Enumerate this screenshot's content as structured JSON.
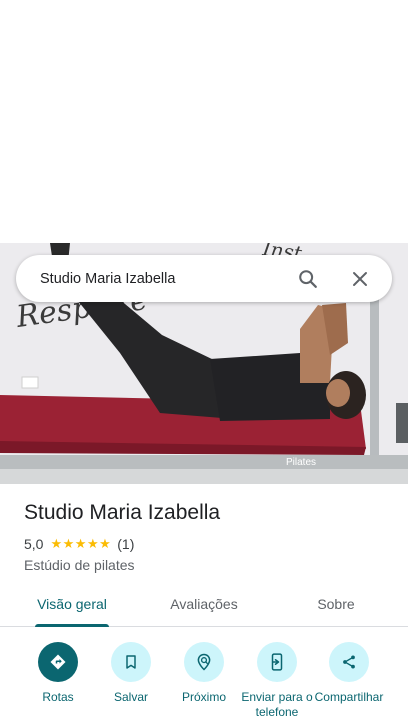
{
  "search": {
    "query": "Studio Maria Izabella"
  },
  "photo": {
    "wall_text": "Respeite",
    "wall_text_top": "Inst",
    "equipment_brand": "Pilates"
  },
  "place": {
    "name": "Studio Maria Izabella",
    "rating": "5,0",
    "stars": 5,
    "review_count": "(1)",
    "category": "Estúdio de pilates"
  },
  "tabs": [
    {
      "label": "Visão geral",
      "active": true
    },
    {
      "label": "Avaliações",
      "active": false
    },
    {
      "label": "Sobre",
      "active": false
    }
  ],
  "actions": [
    {
      "label": "Rotas",
      "icon": "directions-icon"
    },
    {
      "label": "Salvar",
      "icon": "bookmark-icon"
    },
    {
      "label": "Próximo",
      "icon": "nearby-icon"
    },
    {
      "label": "Enviar para o telefone",
      "icon": "send-to-phone-icon"
    },
    {
      "label": "Compartilhar",
      "icon": "share-icon"
    }
  ],
  "colors": {
    "accent": "#0b6670",
    "action_bg": "#cdf5fb",
    "star": "#fbbc04"
  }
}
